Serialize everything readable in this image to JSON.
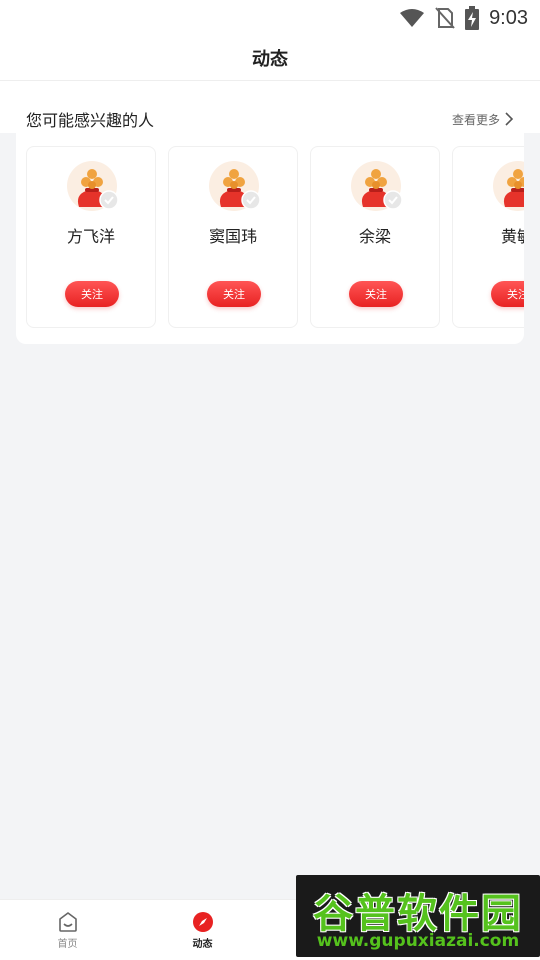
{
  "status_bar": {
    "time": "9:03",
    "icons": [
      "wifi-icon",
      "no-sim-icon",
      "battery-charging-icon"
    ]
  },
  "header": {
    "title": "动态"
  },
  "recommend": {
    "title": "您可能感兴趣的人",
    "see_more": "查看更多",
    "people": [
      {
        "name": "方飞洋",
        "follow_label": "关注"
      },
      {
        "name": "窦国玮",
        "follow_label": "关注"
      },
      {
        "name": "余梁",
        "follow_label": "关注"
      },
      {
        "name": "黄敏",
        "follow_label": "关注"
      }
    ]
  },
  "tabs": [
    {
      "label": "首页",
      "icon": "home-icon",
      "active": false
    },
    {
      "label": "动态",
      "icon": "compass-icon",
      "active": true
    }
  ],
  "watermark": {
    "main": "谷普软件园",
    "url": "www.gupuxiazai.com"
  },
  "colors": {
    "accent": "#e82222",
    "background": "#f3f4f6"
  }
}
